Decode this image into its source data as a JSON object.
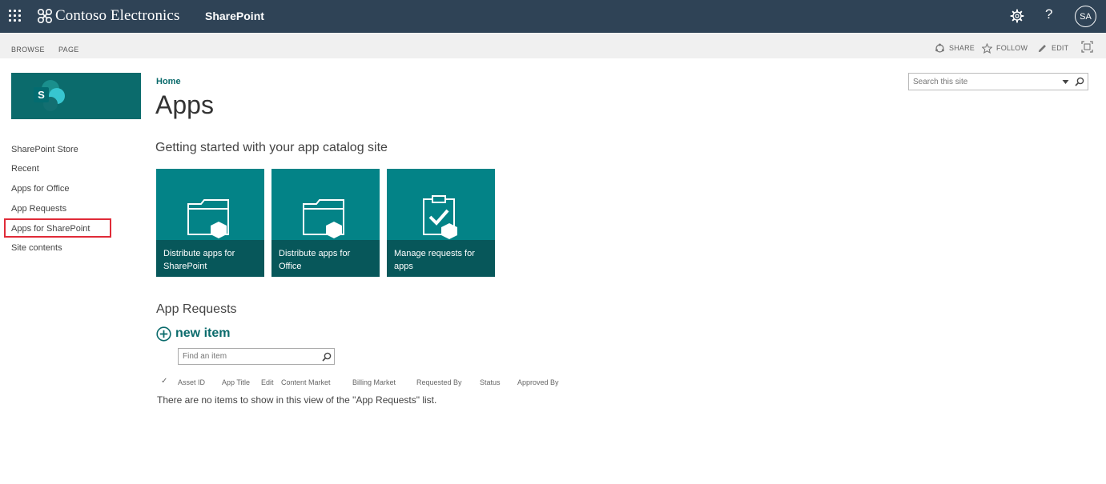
{
  "suitebar": {
    "brand": "Contoso Electronics",
    "app_name": "SharePoint",
    "avatar_initials": "SA",
    "help_glyph": "?",
    "color": "#2f4356"
  },
  "ribbon": {
    "tabs": [
      "BROWSE",
      "PAGE"
    ],
    "actions": {
      "share": "SHARE",
      "follow": "FOLLOW",
      "edit": "EDIT"
    }
  },
  "search": {
    "placeholder": "Search this site"
  },
  "nav": {
    "items": [
      "SharePoint Store",
      "Recent",
      "Apps for Office",
      "App Requests",
      "Apps for SharePoint",
      "Site contents"
    ],
    "highlighted": "Apps for SharePoint"
  },
  "page": {
    "breadcrumb": "Home",
    "title": "Apps",
    "getting_started": "Getting started with your app catalog site"
  },
  "tiles": [
    {
      "label": "Distribute apps for SharePoint",
      "icon": "folder-app-icon"
    },
    {
      "label": "Distribute apps for Office",
      "icon": "folder-app-icon"
    },
    {
      "label": "Manage requests for apps",
      "icon": "clipboard-check-icon"
    }
  ],
  "app_requests": {
    "heading": "App Requests",
    "new_item": "new item",
    "find_placeholder": "Find an item",
    "columns": [
      "Asset ID",
      "App Title",
      "Edit",
      "Content Market",
      "Billing Market",
      "Requested By",
      "Status",
      "Approved By"
    ],
    "empty_message": "There are no items to show in this view of the \"App Requests\" list."
  },
  "colors": {
    "accent": "#0b6b6c",
    "tile": "#038387",
    "tile_caption": "#07575a",
    "highlight": "#e02b38"
  }
}
